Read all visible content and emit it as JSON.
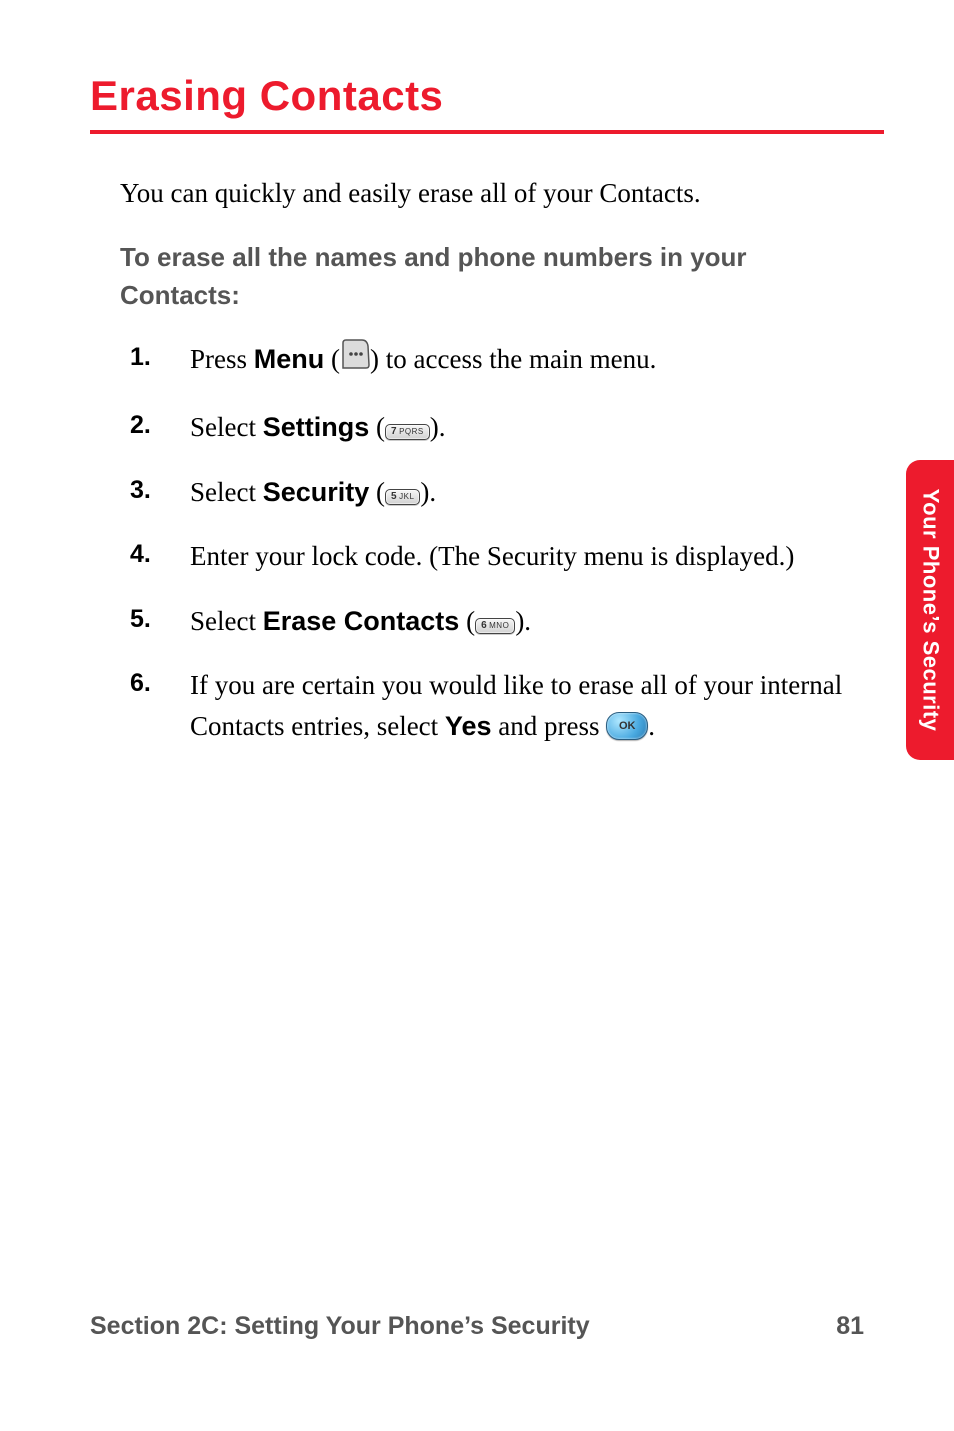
{
  "heading": "Erasing Contacts",
  "intro": "You can quickly and easily erase all of your Contacts.",
  "sub_heading": "To erase all the names and phone numbers in your Contacts:",
  "steps": [
    {
      "num": "1.",
      "pre": "Press ",
      "keyword": "Menu",
      "post_open": " (",
      "icon": "softkey-menu-icon",
      "post_close": ") to access the main menu."
    },
    {
      "num": "2.",
      "pre": "Select ",
      "keyword": "Settings",
      "post_open": " (",
      "icon": "key-7-icon",
      "key_digit": "7",
      "key_letters": "PQRS",
      "post_close": ")."
    },
    {
      "num": "3.",
      "pre": "Select ",
      "keyword": "Security",
      "post_open": " (",
      "icon": "key-5-icon",
      "key_digit": "5",
      "key_letters": "JKL",
      "post_close": ")."
    },
    {
      "num": "4.",
      "text": "Enter your lock code. (The Security menu is displayed.)"
    },
    {
      "num": "5.",
      "pre": "Select ",
      "keyword": "Erase Contacts",
      "post_open": " (",
      "icon": "key-6-icon",
      "key_digit": "6",
      "key_letters": "MNO",
      "post_close": ")."
    },
    {
      "num": "6.",
      "pre": "If you are certain you would like to erase all of your internal Contacts entries, select ",
      "keyword": "Yes",
      "mid": " and press ",
      "icon": "ok-button-icon",
      "ok_label": "OK",
      "end": "."
    }
  ],
  "side_tab": "Your Phone’s Security",
  "footer_left": "Section 2C: Setting Your Phone’s Security",
  "footer_right": "81"
}
